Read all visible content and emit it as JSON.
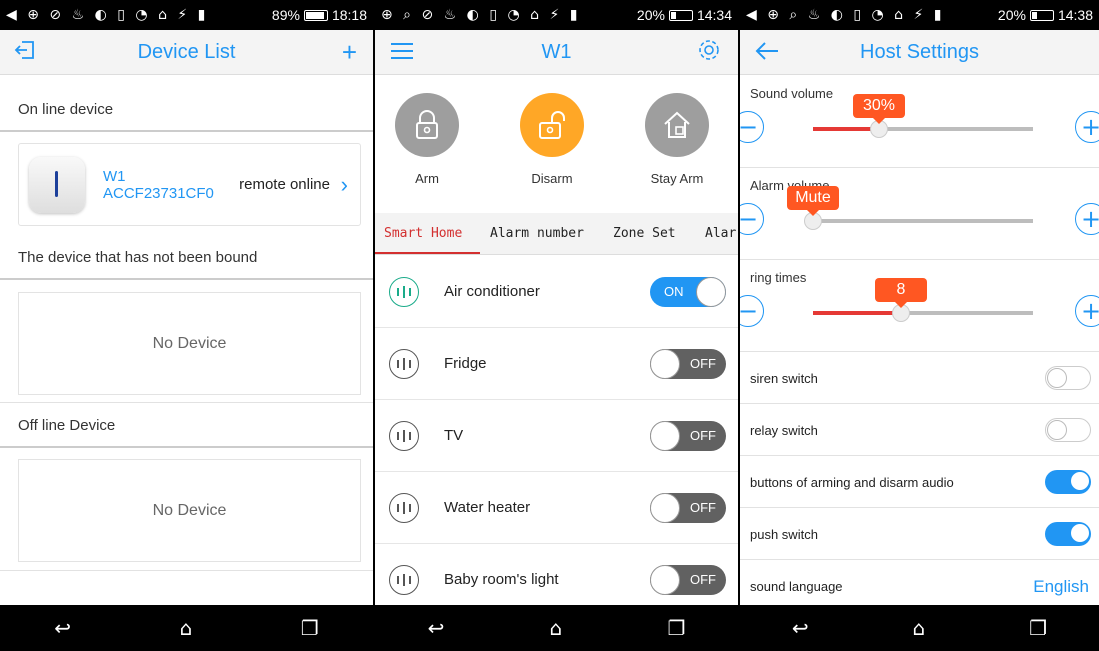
{
  "status": [
    {
      "battery": "89%",
      "time": "18:18",
      "level": 0.89
    },
    {
      "battery": "20%",
      "time": "14:34",
      "level": 0.2
    },
    {
      "battery": "20%",
      "time": "14:38",
      "level": 0.2
    }
  ],
  "device_list": {
    "title": "Device List",
    "online_section": "On line device",
    "device": {
      "name": "W1",
      "id": "ACCF23731CF0",
      "status": "remote online"
    },
    "unbound_section": "The device that has not been bound",
    "unbound_empty": "No Device",
    "offline_section": "Off line Device",
    "offline_empty": "No Device"
  },
  "w1": {
    "title": "W1",
    "modes": [
      {
        "label": "Arm",
        "color": "#9e9e9e"
      },
      {
        "label": "Disarm",
        "color": "#ffa726"
      },
      {
        "label": "Stay Arm",
        "color": "#9e9e9e"
      }
    ],
    "tabs": [
      "Smart Home",
      "Alarm number",
      "Zone Set",
      "Alar"
    ],
    "appliances": [
      {
        "name": "Air conditioner",
        "state": "ON"
      },
      {
        "name": "Fridge",
        "state": "OFF"
      },
      {
        "name": "TV",
        "state": "OFF"
      },
      {
        "name": "Water heater",
        "state": "OFF"
      },
      {
        "name": "Baby room's light",
        "state": "OFF"
      }
    ]
  },
  "host_settings": {
    "title": "Host Settings",
    "sliders": [
      {
        "label": "Sound volume",
        "value": "30%",
        "fraction": 0.3
      },
      {
        "label": "Alarm volume",
        "value": "Mute",
        "fraction": 0.0
      },
      {
        "label": "ring times",
        "value": "8",
        "fraction": 0.4
      }
    ],
    "toggles": [
      {
        "label": "siren switch",
        "on": false
      },
      {
        "label": "relay switch",
        "on": false
      },
      {
        "label": "buttons of arming and disarm audio",
        "on": true
      },
      {
        "label": "push switch",
        "on": true
      }
    ],
    "language_label": "sound language",
    "language_value": "English"
  },
  "colors": {
    "accent": "#2196f3",
    "bubble": "#ff5722",
    "active_tab": "#d32f2f"
  }
}
